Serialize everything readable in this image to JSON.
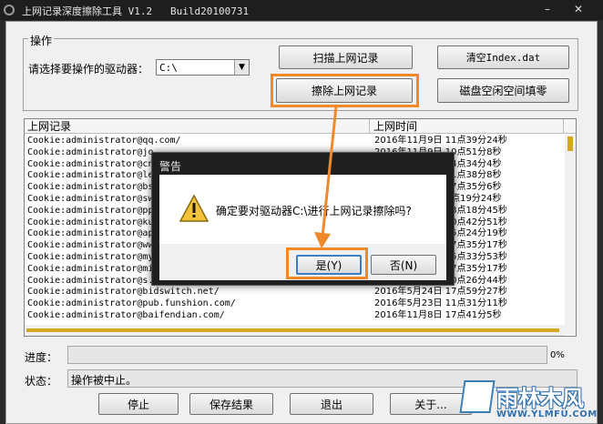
{
  "window": {
    "title": "上网记录深度擦除工具 V1.2   Build20100731",
    "minimize": "–",
    "close": "✕"
  },
  "ops": {
    "group_label": "操作",
    "drive_label": "请选择要操作的驱动器：",
    "drive_value": "C:\\",
    "scan_button": "扫描上网记录",
    "clear_index_button": "清空Index.dat",
    "erase_button": "擦除上网记录",
    "wipe_free_button": "磁盘空闲空间填零"
  },
  "table": {
    "col1": "上网记录",
    "col2": "上网时间",
    "rows": [
      {
        "record": "Cookie:administrator@qq.com/",
        "time": "2016年11月9日  11点39分24秒"
      },
      {
        "record": "Cookie:administrator@jo",
        "time": "2016年11月9日  10点51分8秒"
      },
      {
        "record": "Cookie:administrator@cn",
        "time": "2016年11月9日  14点34分4秒"
      },
      {
        "record": "Cookie:administrator@le",
        "time": "2016年11月9日  11点38分8秒"
      },
      {
        "record": "Cookie:administrator@bs",
        "time": "2016年11月9日  17点35分6秒"
      },
      {
        "record": "Cookie:administrator@sw",
        "time": "2016年11月9日  9点19分24秒"
      },
      {
        "record": "Cookie:administrator@pp",
        "time": "2016年11月9日  18点18分45秒"
      },
      {
        "record": "Cookie:administrator@ku",
        "time": "2016年11月9日  10点42分51秒"
      },
      {
        "record": "Cookie:administrator@ap",
        "time": "2016年11月9日  15点24分19秒"
      },
      {
        "record": "Cookie:administrator@ww",
        "time": "2016年11月9日  17点35分17秒"
      },
      {
        "record": "Cookie:administrator@my",
        "time": "2016年11月9日  15点33分53秒"
      },
      {
        "record": "Cookie:administrator@mi",
        "time": "2016年11月9日  17点35分17秒"
      },
      {
        "record": "Cookie:administrator@s.",
        "time": "2016年11月9日  10点26分44秒"
      },
      {
        "record": "Cookie:administrator@bidswitch.net/",
        "time": "2016年5月24日  17点59分27秒"
      },
      {
        "record": "Cookie:administrator@pub.funshion.com/",
        "time": "2016年5月23日  11点31分11秒"
      },
      {
        "record": "Cookie:administrator@baifendian.com/",
        "time": "2016年11月8日  17点41分5秒"
      }
    ]
  },
  "progress": {
    "label": "进度：",
    "percent_text": "0%",
    "value": 0
  },
  "status": {
    "label": "状态：",
    "value": "操作被中止。"
  },
  "bottom": {
    "stop_button": "停止",
    "save_button": "保存结果",
    "exit_button": "退出",
    "about_button": "关于..."
  },
  "dialog": {
    "title": "警告",
    "message": "确定要对驱动器C:\\进行上网记录擦除吗?",
    "yes_button": "是(Y)",
    "no_button": "否(N)"
  },
  "watermark": {
    "text": "雨林木风",
    "url": "WWW.YLMFU.COM"
  },
  "colors": {
    "accent": "#f0892a",
    "titlebar": "#1e1e1e",
    "panel": "#f0f0f0"
  }
}
